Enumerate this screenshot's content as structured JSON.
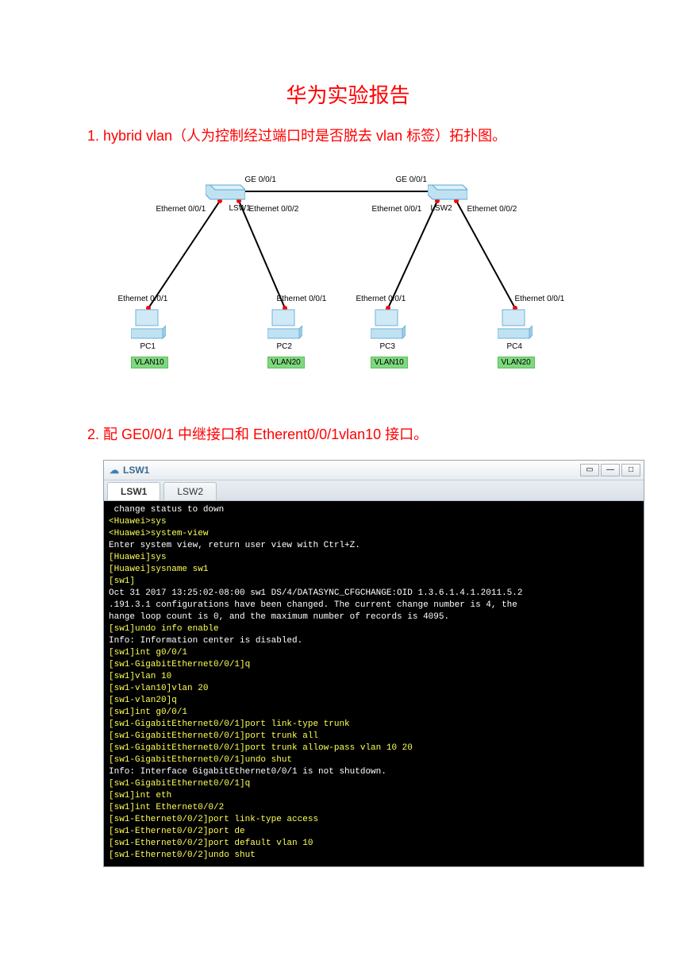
{
  "title": "华为实验报告",
  "section1": "1.  hybrid vlan（人为控制经过端口时是否脱去 vlan 标签）拓扑图。",
  "section2": "2.  配 GE0/0/1 中继接口和 Etherent0/0/1vlan10 接口。",
  "topology": {
    "switches": [
      {
        "name": "LSW1"
      },
      {
        "name": "LSW2"
      }
    ],
    "pcs": [
      {
        "name": "PC1",
        "vlan": "VLAN10"
      },
      {
        "name": "PC2",
        "vlan": "VLAN20"
      },
      {
        "name": "PC3",
        "vlan": "VLAN10"
      },
      {
        "name": "PC4",
        "vlan": "VLAN20"
      }
    ],
    "port_labels": {
      "ge001_left": "GE 0/0/1",
      "ge001_right": "GE 0/0/1",
      "eth001": "Ethernet 0/0/1",
      "eth002": "Ethernet 0/0/2"
    }
  },
  "window": {
    "title": "LSW1",
    "tabs": [
      "LSW1",
      "LSW2"
    ]
  },
  "terminal_lines": [
    {
      "c": "w",
      "t": " change status to down"
    },
    {
      "c": "y",
      "t": "<Huawei>sys"
    },
    {
      "c": "y",
      "t": "<Huawei>system-view"
    },
    {
      "c": "w",
      "t": "Enter system view, return user view with Ctrl+Z."
    },
    {
      "c": "y",
      "t": "[Huawei]sys"
    },
    {
      "c": "y",
      "t": "[Huawei]sysname sw1"
    },
    {
      "c": "y",
      "t": "[sw1]"
    },
    {
      "c": "w",
      "t": "Oct 31 2017 13:25:02-08:00 sw1 DS/4/DATASYNC_CFGCHANGE:OID 1.3.6.1.4.1.2011.5.2"
    },
    {
      "c": "w",
      "t": ".191.3.1 configurations have been changed. The current change number is 4, the "
    },
    {
      "c": "w",
      "t": "hange loop count is 0, and the maximum number of records is 4095."
    },
    {
      "c": "y",
      "t": "[sw1]undo info enable"
    },
    {
      "c": "w",
      "t": "Info: Information center is disabled."
    },
    {
      "c": "y",
      "t": "[sw1]int g0/0/1"
    },
    {
      "c": "y",
      "t": "[sw1-GigabitEthernet0/0/1]q"
    },
    {
      "c": "y",
      "t": "[sw1]vlan 10"
    },
    {
      "c": "y",
      "t": "[sw1-vlan10]vlan 20"
    },
    {
      "c": "y",
      "t": "[sw1-vlan20]q"
    },
    {
      "c": "y",
      "t": "[sw1]int g0/0/1"
    },
    {
      "c": "y",
      "t": "[sw1-GigabitEthernet0/0/1]port link-type trunk"
    },
    {
      "c": "y",
      "t": "[sw1-GigabitEthernet0/0/1]port trunk all"
    },
    {
      "c": "y",
      "t": "[sw1-GigabitEthernet0/0/1]port trunk allow-pass vlan 10 20"
    },
    {
      "c": "y",
      "t": "[sw1-GigabitEthernet0/0/1]undo shut"
    },
    {
      "c": "w",
      "t": "Info: Interface GigabitEthernet0/0/1 is not shutdown."
    },
    {
      "c": "y",
      "t": "[sw1-GigabitEthernet0/0/1]q"
    },
    {
      "c": "y",
      "t": "[sw1]int eth"
    },
    {
      "c": "y",
      "t": "[sw1]int Ethernet0/0/2"
    },
    {
      "c": "y",
      "t": "[sw1-Ethernet0/0/2]port link-type access"
    },
    {
      "c": "y",
      "t": "[sw1-Ethernet0/0/2]port de"
    },
    {
      "c": "y",
      "t": "[sw1-Ethernet0/0/2]port default vlan 10"
    },
    {
      "c": "y",
      "t": "[sw1-Ethernet0/0/2]undo shut"
    }
  ]
}
